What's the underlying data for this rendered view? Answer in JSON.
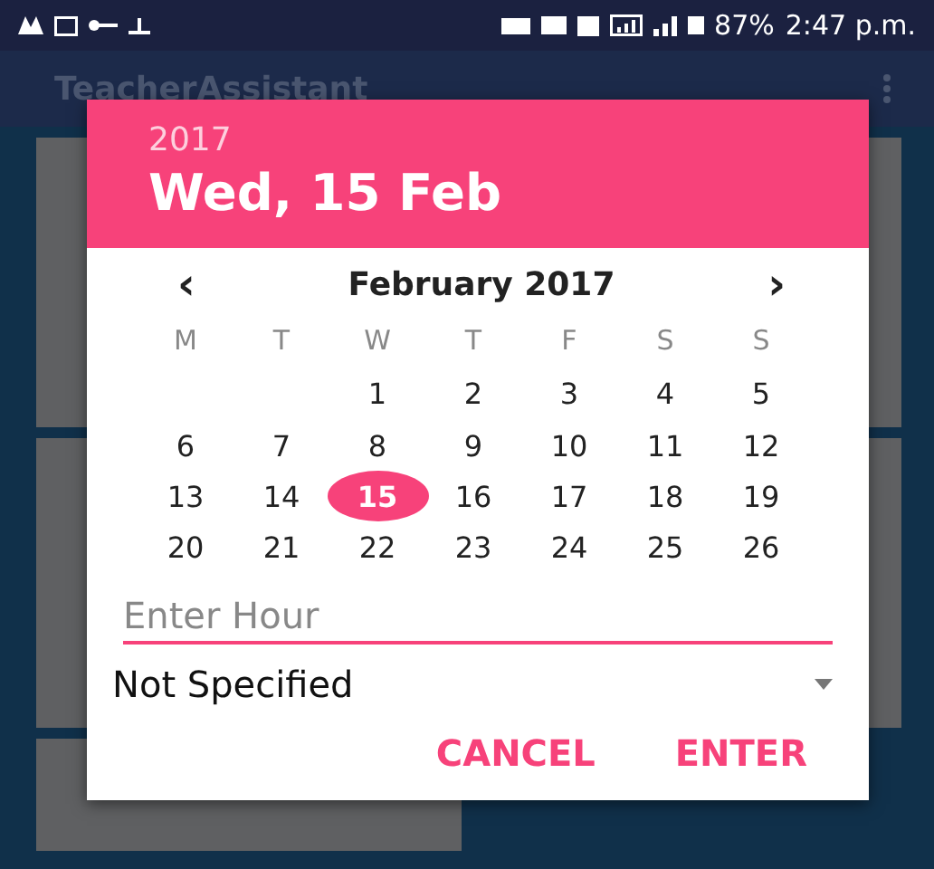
{
  "status_bar": {
    "battery": "87%",
    "time": "2:47 p.m."
  },
  "app_bar": {
    "title": "TeacherAssistant"
  },
  "dialog": {
    "year": "2017",
    "date": "Wed, 15 Feb",
    "month": "February 2017",
    "prev": "‹",
    "next": "›",
    "weekdays": [
      "M",
      "T",
      "W",
      "T",
      "F",
      "S",
      "S"
    ],
    "weeks": [
      [
        {
          "kind": "blank"
        },
        {
          "kind": "blank"
        },
        {
          "kind": "day",
          "label": "1",
          "selected": false
        },
        {
          "kind": "day",
          "label": "2",
          "selected": false
        },
        {
          "kind": "day",
          "label": "3",
          "selected": false
        },
        {
          "kind": "day",
          "label": "4",
          "selected": false
        },
        {
          "kind": "day",
          "label": "5",
          "selected": false
        }
      ],
      [
        {
          "kind": "day",
          "label": "6",
          "selected": false
        },
        {
          "kind": "day",
          "label": "7",
          "selected": false
        },
        {
          "kind": "day",
          "label": "8",
          "selected": false
        },
        {
          "kind": "day",
          "label": "9",
          "selected": false
        },
        {
          "kind": "day",
          "label": "10",
          "selected": false
        },
        {
          "kind": "day",
          "label": "11",
          "selected": false
        },
        {
          "kind": "day",
          "label": "12",
          "selected": false
        }
      ],
      [
        {
          "kind": "day",
          "label": "13",
          "selected": false
        },
        {
          "kind": "day",
          "label": "14",
          "selected": false
        },
        {
          "kind": "day",
          "label": "15",
          "selected": true
        },
        {
          "kind": "day",
          "label": "16",
          "selected": false
        },
        {
          "kind": "day",
          "label": "17",
          "selected": false
        },
        {
          "kind": "day",
          "label": "18",
          "selected": false
        },
        {
          "kind": "day",
          "label": "19",
          "selected": false
        }
      ],
      [
        {
          "kind": "day",
          "label": "20",
          "selected": false
        },
        {
          "kind": "day",
          "label": "21",
          "selected": false
        },
        {
          "kind": "day",
          "label": "22",
          "selected": false
        },
        {
          "kind": "day",
          "label": "23",
          "selected": false
        },
        {
          "kind": "day",
          "label": "24",
          "selected": false
        },
        {
          "kind": "day",
          "label": "25",
          "selected": false
        },
        {
          "kind": "day",
          "label": "26",
          "selected": false
        }
      ]
    ],
    "hour_field": {
      "placeholder": "Enter Hour"
    },
    "spinner": {
      "value": "Not Specified"
    },
    "buttons": [
      "CANCEL",
      "ENTER"
    ]
  }
}
